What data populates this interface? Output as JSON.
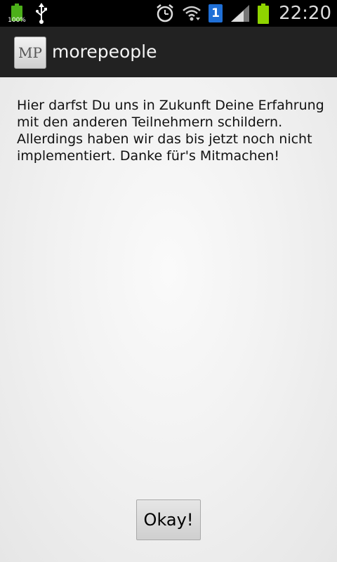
{
  "status_bar": {
    "battery_small_label": "100%",
    "sim_number": "1",
    "time": "22:20",
    "icons": [
      "battery-charging-icon",
      "usb-icon",
      "alarm-icon",
      "wifi-icon",
      "sim-icon",
      "signal-icon",
      "battery-icon"
    ]
  },
  "action_bar": {
    "icon_text": "MP",
    "title": "morepeople"
  },
  "content": {
    "message": "Hier darfst Du uns in Zukunft Deine Erfahrung mit den anderen Teilnehmern schildern. Allerdings haben wir das bis jetzt noch nicht implementiert. Danke für's Mitmachen!"
  },
  "buttons": {
    "okay": "Okay!"
  },
  "colors": {
    "status_bar_bg": "#000000",
    "action_bar_bg": "#222222",
    "content_bg": "#ececec",
    "battery_green": "#8fd400",
    "sim_blue": "#1f6fd6"
  }
}
